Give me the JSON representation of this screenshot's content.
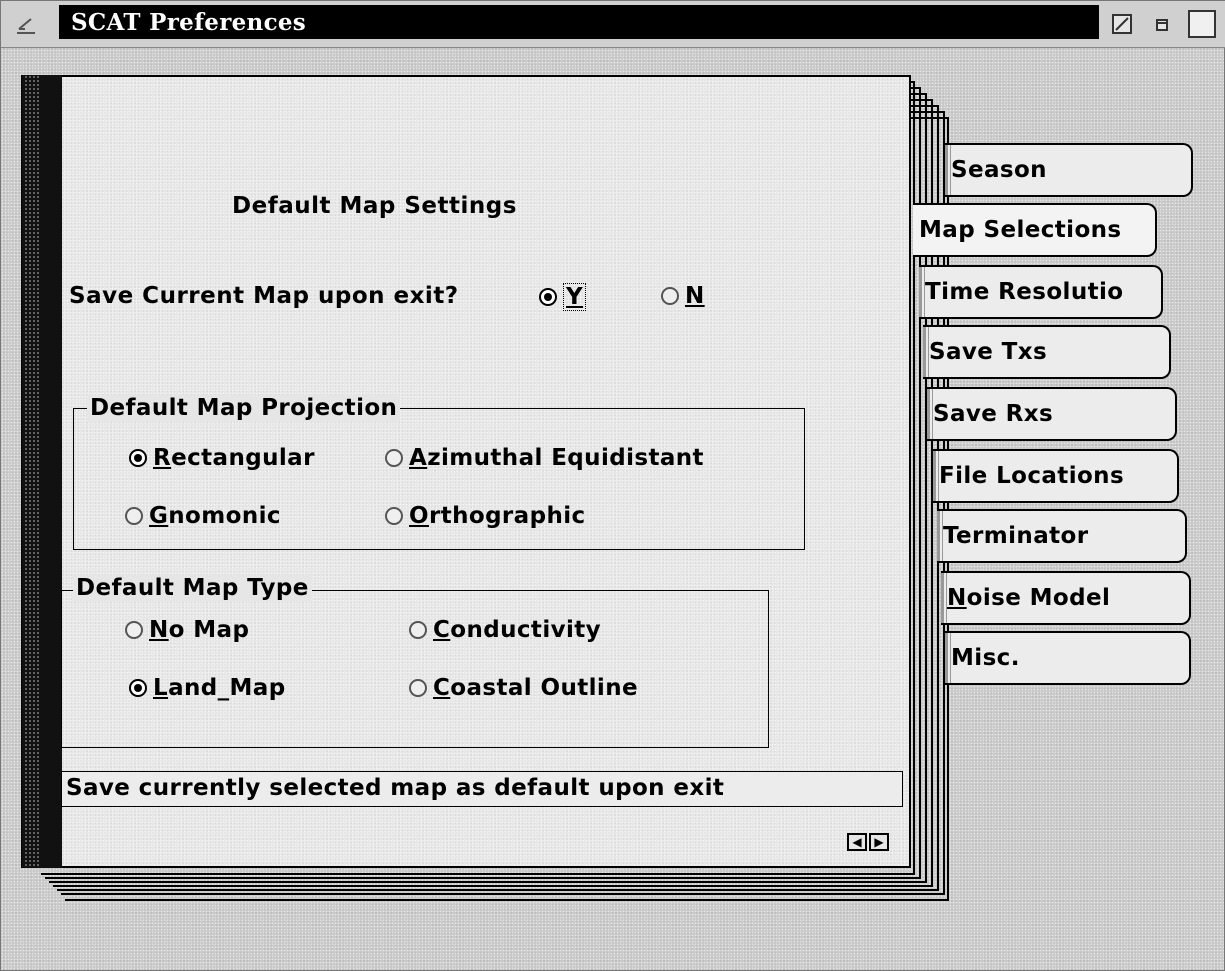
{
  "window": {
    "title": "SCAT Preferences",
    "accent_color": "#000000",
    "background_color": "#c9c9c9"
  },
  "page": {
    "heading": "Default Map Settings",
    "save_question": {
      "label": "Save Current Map upon exit?",
      "options": [
        {
          "mnemonic": "Y",
          "rest": "",
          "selected": true
        },
        {
          "mnemonic": "N",
          "rest": "",
          "selected": false
        }
      ]
    },
    "projection": {
      "title": "Default Map Projection",
      "options": [
        {
          "mnemonic": "R",
          "rest": "ectangular",
          "selected": true
        },
        {
          "mnemonic": "A",
          "rest": "zimuthal Equidistant",
          "selected": false
        },
        {
          "mnemonic": "G",
          "rest": "nomonic",
          "selected": false
        },
        {
          "mnemonic": "O",
          "rest": "rthographic",
          "selected": false
        }
      ]
    },
    "map_type": {
      "title": "Default Map Type",
      "options": [
        {
          "mnemonic": "N",
          "rest": "o Map",
          "selected": false
        },
        {
          "mnemonic": "C",
          "rest": "onductivity",
          "selected": false
        },
        {
          "mnemonic": "L",
          "rest": "and_Map",
          "selected": true
        },
        {
          "mnemonic": "C",
          "rest": "oastal Outline",
          "selected": false
        }
      ]
    },
    "status_text": "Save currently selected map as default upon exit",
    "page_arrows": {
      "prev": "left-arrow-icon",
      "next": "right-arrow-icon"
    }
  },
  "tabs": [
    {
      "label": "Season",
      "active": false
    },
    {
      "label": "Map Selections",
      "active": true
    },
    {
      "label": "Time Resolutio",
      "active": false
    },
    {
      "label": "Save Txs",
      "active": false
    },
    {
      "label": "Save Rxs",
      "active": false
    },
    {
      "label": "File Locations",
      "active": false
    },
    {
      "label": "Terminator",
      "active": false
    },
    {
      "label": "Noise Model",
      "active": false
    },
    {
      "label": "Misc.",
      "active": false
    }
  ],
  "icons": {
    "system_menu": "system-menu-icon",
    "minimize": "minimize-icon",
    "maximize": "maximize-icon",
    "restore": "restore-icon"
  }
}
